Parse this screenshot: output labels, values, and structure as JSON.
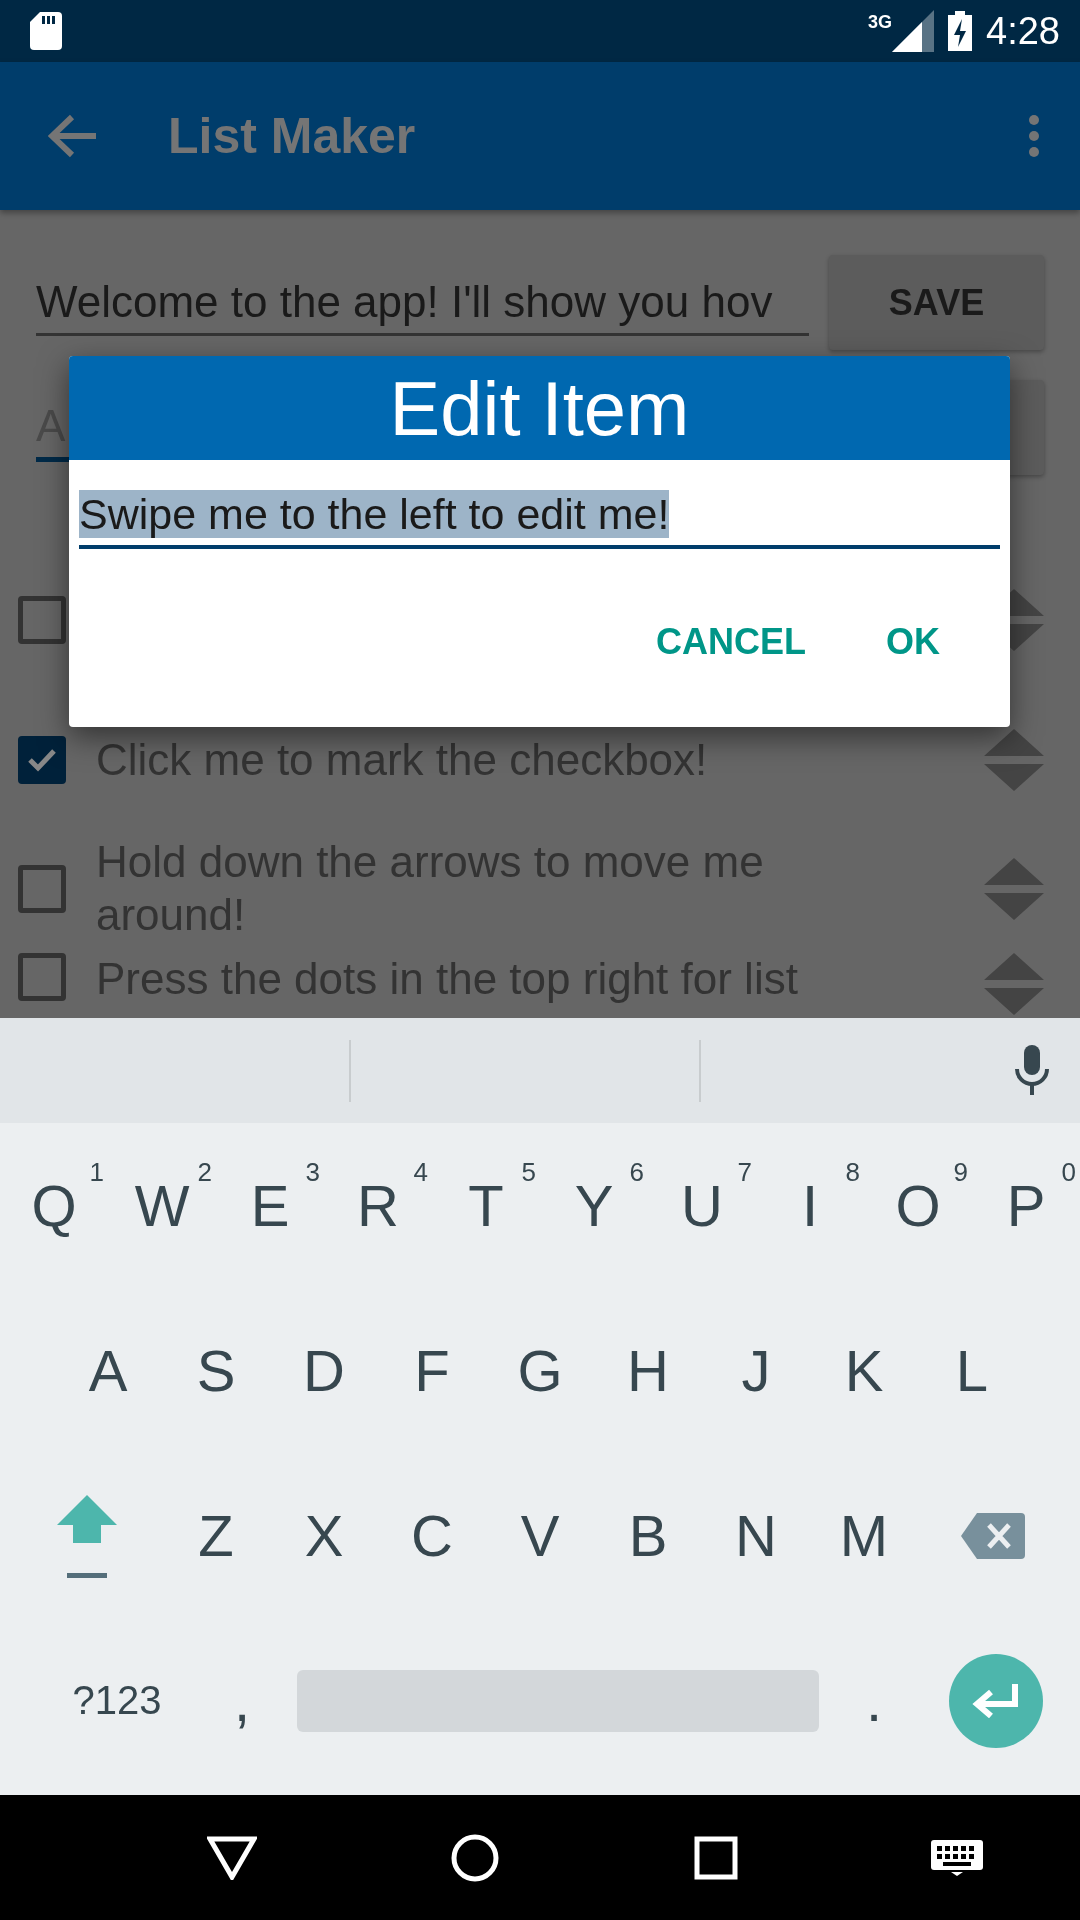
{
  "status_bar": {
    "network": "3G",
    "time": "4:28"
  },
  "app_bar": {
    "title": "List Maker"
  },
  "list_title_field": {
    "value": "Welcome to the app! I'll show you hov"
  },
  "save_button": {
    "label": "SAVE"
  },
  "add_item_field": {
    "placeholder": "A"
  },
  "items": [
    {
      "checked": false
    },
    {
      "text": "Click me to mark the checkbox!",
      "checked": true
    },
    {
      "text": "Hold down the arrows to move me around!",
      "checked": false
    },
    {
      "text": "Press the dots in the top right for list",
      "checked": false
    }
  ],
  "dialog": {
    "title": "Edit Item",
    "value": "Swipe me to the left to edit me!",
    "text_selected": true,
    "buttons": [
      "CANCEL",
      "OK"
    ]
  },
  "keyboard": {
    "rows": [
      [
        {
          "label": "Q",
          "hint": "1"
        },
        {
          "label": "W",
          "hint": "2"
        },
        {
          "label": "E",
          "hint": "3"
        },
        {
          "label": "R",
          "hint": "4"
        },
        {
          "label": "T",
          "hint": "5"
        },
        {
          "label": "Y",
          "hint": "6"
        },
        {
          "label": "U",
          "hint": "7"
        },
        {
          "label": "I",
          "hint": "8"
        },
        {
          "label": "O",
          "hint": "9"
        },
        {
          "label": "P",
          "hint": "0"
        }
      ],
      [
        {
          "label": "A"
        },
        {
          "label": "S"
        },
        {
          "label": "D"
        },
        {
          "label": "F"
        },
        {
          "label": "G"
        },
        {
          "label": "H"
        },
        {
          "label": "J"
        },
        {
          "label": "K"
        },
        {
          "label": "L"
        }
      ],
      [
        {
          "label": "Z"
        },
        {
          "label": "X"
        },
        {
          "label": "C"
        },
        {
          "label": "V"
        },
        {
          "label": "B"
        },
        {
          "label": "N"
        },
        {
          "label": "M"
        }
      ]
    ],
    "symbols_key": "?123",
    "comma_key": ",",
    "period_key": "."
  }
}
